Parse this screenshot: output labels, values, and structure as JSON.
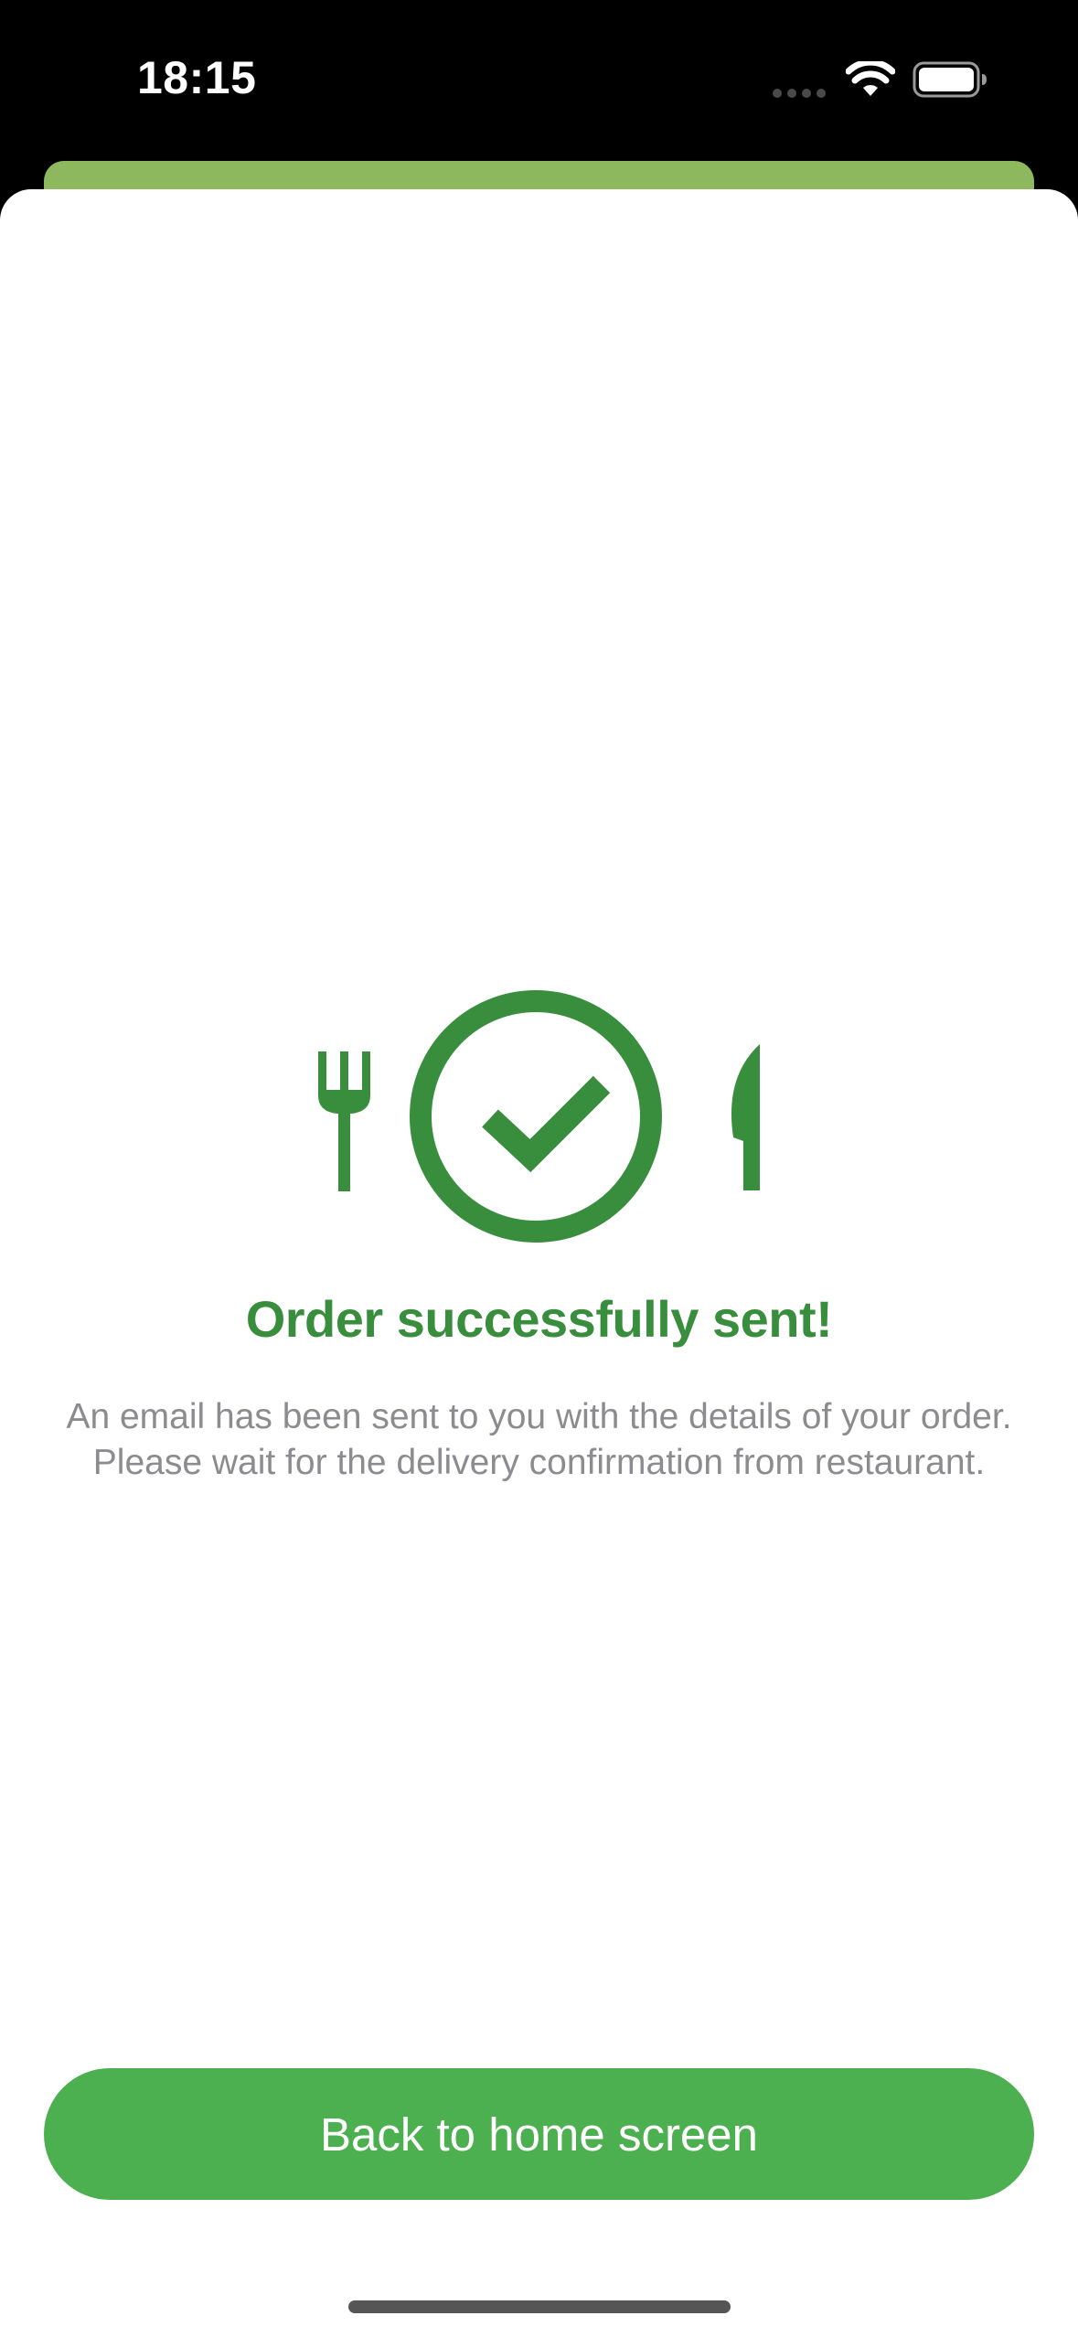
{
  "status_bar": {
    "time": "18:15",
    "icons": [
      "cellular-signal-icon",
      "wifi-icon",
      "battery-icon"
    ]
  },
  "colors": {
    "accent_dark_green": "#388e3c",
    "button_green": "#4caf50",
    "sheet_behind_green": "#8db85e",
    "message_gray": "#8c8c90"
  },
  "illustration": {
    "icons": [
      "fork-icon",
      "checkmark-circle-icon",
      "knife-icon"
    ]
  },
  "success": {
    "title": "Order successfully sent!",
    "message": "An email has been sent to you with the details of your order. Please wait for the delivery confirmation from restaurant."
  },
  "actions": {
    "home_button_label": "Back to home screen"
  }
}
